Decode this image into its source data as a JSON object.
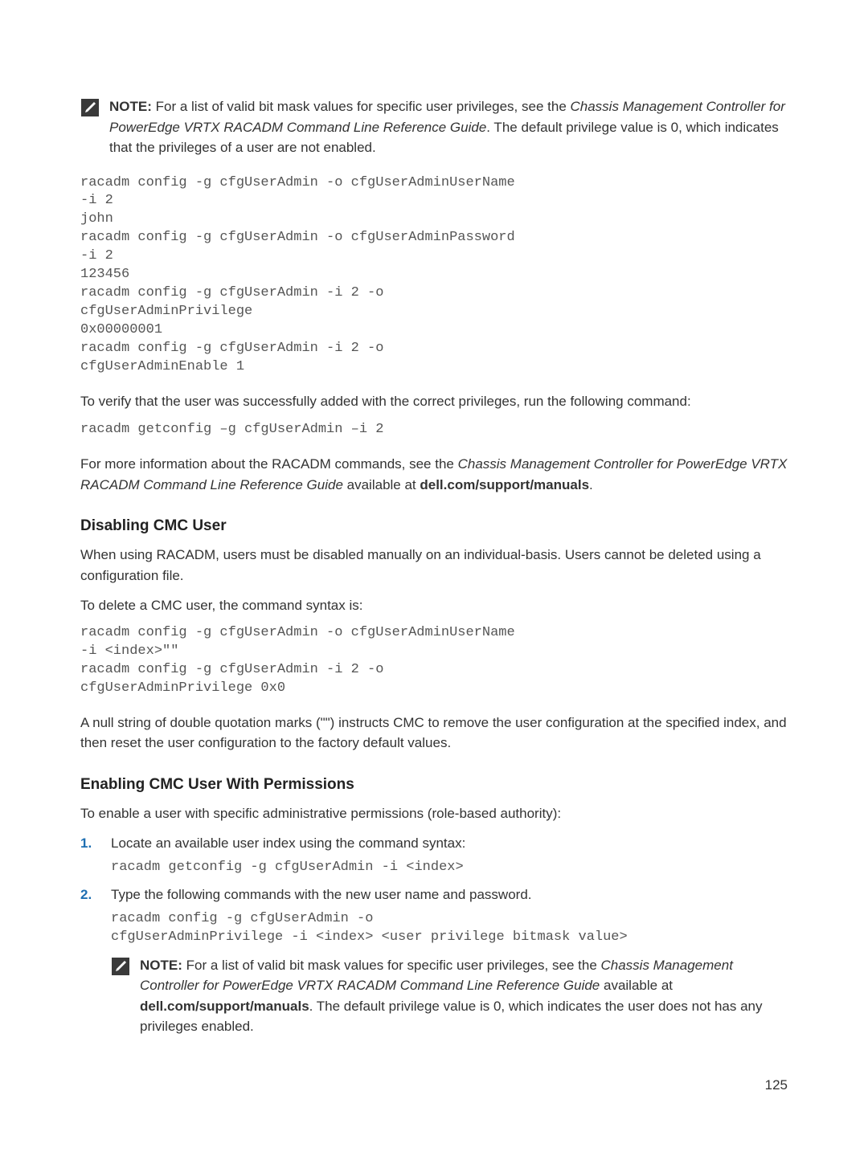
{
  "note1": {
    "label": "NOTE:",
    "text_before": " For a list of valid bit mask values for specific user privileges, see the ",
    "italic": "Chassis Management Controller for PowerEdge VRTX RACADM Command Line Reference Guide",
    "text_after": ". The default privilege value is 0, which indicates that the privileges of a user are not enabled."
  },
  "code1": "racadm config -g cfgUserAdmin -o cfgUserAdminUserName\n-i 2\njohn\nracadm config -g cfgUserAdmin -o cfgUserAdminPassword\n-i 2\n123456\nracadm config -g cfgUserAdmin -i 2 -o\ncfgUserAdminPrivilege\n0x00000001\nracadm config -g cfgUserAdmin -i 2 -o\ncfgUserAdminEnable 1",
  "para1": "To verify that the user was successfully added with the correct privileges, run the following command:",
  "code2": "racadm getconfig –g cfgUserAdmin –i 2",
  "para2_before": "For more information about the RACADM commands, see the ",
  "para2_italic": "Chassis Management Controller for PowerEdge VRTX RACADM Command Line Reference Guide",
  "para2_mid": " available at ",
  "para2_bold": "dell.com/support/manuals",
  "para2_after": ".",
  "heading1": "Disabling CMC User",
  "para3": "When using RACADM, users must be disabled manually on an individual-basis. Users cannot be deleted using a configuration file.",
  "para4": "To delete a CMC user, the command syntax is:",
  "code3": "racadm config -g cfgUserAdmin -o cfgUserAdminUserName\n-i <index>\"\"\nracadm config -g cfgUserAdmin -i 2 -o\ncfgUserAdminPrivilege 0x0",
  "para5": "A null string of double quotation marks (\"\") instructs CMC to remove the user configuration at the specified index, and then reset the user configuration to the factory default values.",
  "heading2": "Enabling CMC User With Permissions",
  "para6": "To enable a user with specific administrative permissions (role-based authority):",
  "step1": {
    "num": "1.",
    "text": "Locate an available user index using the command syntax:",
    "code": "racadm getconfig -g cfgUserAdmin -i <index>"
  },
  "step2": {
    "num": "2.",
    "text": "Type the following commands with the new user name and password.",
    "code": "racadm config -g cfgUserAdmin -o\ncfgUserAdminPrivilege -i <index> <user privilege bitmask value>"
  },
  "note2": {
    "label": "NOTE:",
    "text_before": " For a list of valid bit mask values for specific user privileges, see the ",
    "italic": "Chassis Management Controller for PowerEdge VRTX RACADM Command Line Reference Guide",
    "mid": " available at ",
    "bold": "dell.com/support/manuals",
    "text_after": ". The default privilege value is 0, which indicates the user does not has any privileges enabled."
  },
  "page_number": "125"
}
